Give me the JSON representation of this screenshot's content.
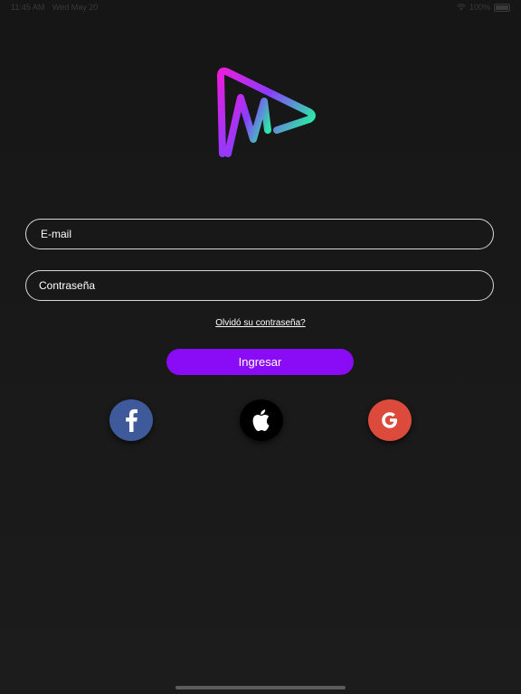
{
  "status_bar": {
    "time": "11:45 AM",
    "date": "Wed May 20",
    "battery": "100%",
    "wifi_icon": "wifi-icon",
    "battery_icon": "battery-icon"
  },
  "logo": {
    "icon": "app-logo-m-play-icon",
    "gradient_colors": [
      "#e91edc",
      "#8a3cff",
      "#2ee6a8"
    ]
  },
  "form": {
    "email_placeholder": "E-mail",
    "password_placeholder": "Contraseña",
    "forgot_password_label": "Olvidó su contraseña?",
    "login_label": "Ingresar"
  },
  "social": {
    "facebook": {
      "icon": "facebook-icon",
      "color": "#3f5a9a"
    },
    "apple": {
      "icon": "apple-icon",
      "color": "#000000"
    },
    "google": {
      "icon": "google-icon",
      "color": "#dc4a3c"
    }
  },
  "colors": {
    "background": "#1a1a1a",
    "accent": "#8a0bf5",
    "input_border": "#d8d8d8"
  }
}
